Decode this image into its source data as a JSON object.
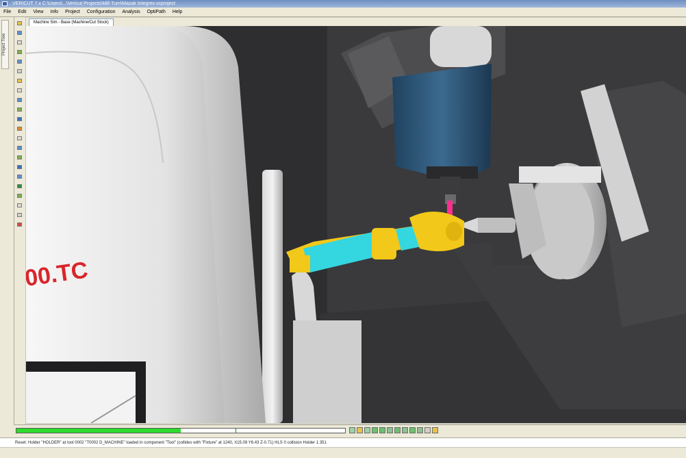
{
  "window": {
    "title": "VERICUT 7.x  C:\\Users\\...\\Vericut Projects\\Mill-Turn\\Mazak Integrex.vcproject"
  },
  "menu": {
    "items": [
      "File",
      "Edit",
      "View",
      "Info",
      "Project",
      "Configuration",
      "Analysis",
      "OptiPath",
      "Help"
    ]
  },
  "left_panel": {
    "tab_label": "Project Tree"
  },
  "document": {
    "tab_label": "Machine Sim - Base (Machine/Cut Stock)"
  },
  "viewport": {
    "machine_label": "00.TC",
    "colors": {
      "background": "#2b2b2d",
      "guard": "#e6e6e6",
      "spindle_head": "#2f5877",
      "workpiece": "#f2c81a",
      "cut_region": "#34d6e0",
      "tool": "#ff2f8f",
      "label": "#d9262b"
    }
  },
  "simulation": {
    "progress": 0.5,
    "progress_color": "#2ddc2d",
    "controls": [
      "play-icon",
      "pause-icon",
      "step-icon",
      "stop-icon",
      "rewind-icon",
      "options-icon",
      "speed-icon",
      "settings-icon",
      "info-icon",
      "close-icon",
      "help-icon",
      "extra-icon"
    ]
  },
  "status": {
    "message": "Reset: Holder \"HOLDER\" at tool 0002 \"T0002 D_MACHINE\" loaded in component \"Tool\" (collides with \"Fixture\" at 1240, X15.09 Y6.43 Z-0.71) HLS 0 collision Holder 1.351"
  }
}
